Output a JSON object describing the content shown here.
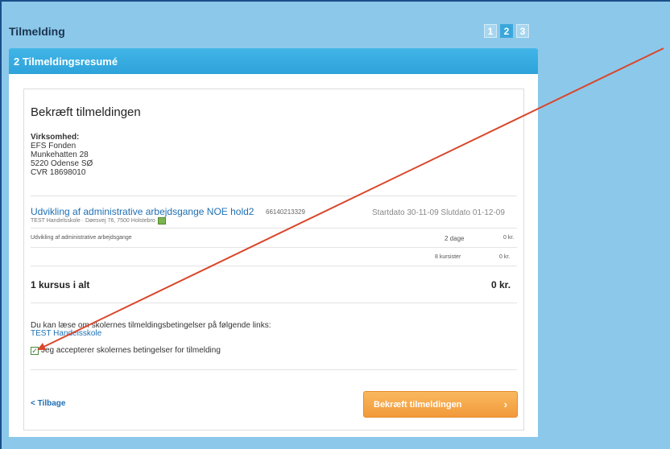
{
  "header": {
    "title": "Tilmelding",
    "steps": [
      "1",
      "2",
      "3"
    ]
  },
  "section": {
    "title": "2 Tilmeldingsresumé"
  },
  "card": {
    "title": "Bekræft tilmeldingen",
    "company": {
      "label": "Virksomhed:",
      "name": "EFS Fonden",
      "street": "Munkehatten 28",
      "city": "5220 Odense SØ",
      "cvr": "CVR 18698010"
    },
    "course": {
      "title": "Udvikling af administrative arbejdsgange NOE hold2",
      "code": "66140213329",
      "school_address": "TEST Handelsskole · Døesvej 76, 7500 Holstebro",
      "dates": "Startdato 30-11-09  Slutdato 01-12-09",
      "description": "Udvikling af administrative arbejdsgange",
      "duration": "2 dage",
      "price": "0 kr.",
      "participants": "8 kursister",
      "participants_price": "0 kr."
    },
    "total": {
      "label": "1 kursus i alt",
      "value": "0 kr."
    },
    "terms": {
      "info": "Du kan læse om skolernes tilmeldingsbetingelser på følgende links:",
      "school_link": "TEST Handelsskole",
      "accept_label": "Jeg accepterer skolernes betingelser for tilmelding"
    },
    "actions": {
      "back": "< Tilbage",
      "confirm": "Bekræft tilmeldingen",
      "confirm_chevron": "›"
    }
  },
  "colors": {
    "accent": "#2ea3da",
    "button": "#f29a3a",
    "annotation": "#d9472b"
  }
}
